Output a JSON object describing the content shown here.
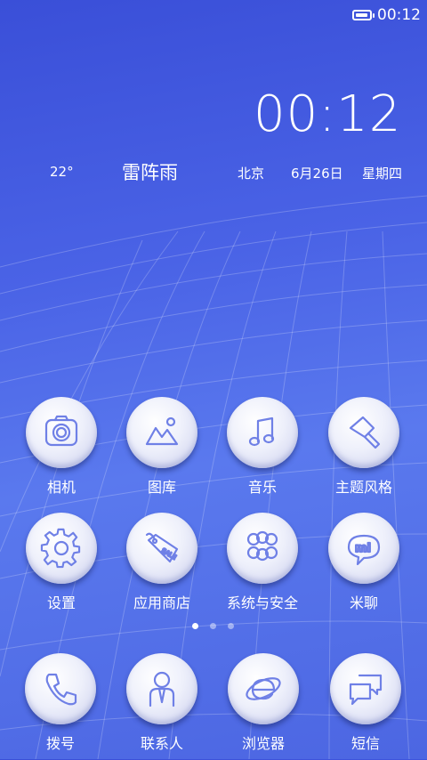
{
  "status_bar": {
    "time": "00:12",
    "battery_level": 0.95,
    "icons": [
      "battery-icon"
    ]
  },
  "lock_widget": {
    "clock": "00:12",
    "temperature": "22°",
    "condition": "雷阵雨",
    "city": "北京",
    "date": "6月26日",
    "weekday": "星期四"
  },
  "apps": [
    {
      "label": "相机",
      "icon": "camera-icon"
    },
    {
      "label": "图库",
      "icon": "gallery-icon"
    },
    {
      "label": "音乐",
      "icon": "music-icon"
    },
    {
      "label": "主题风格",
      "icon": "theme-brush-icon"
    },
    {
      "label": "设置",
      "icon": "settings-gear-icon"
    },
    {
      "label": "应用商店",
      "icon": "app-store-tag-icon"
    },
    {
      "label": "系统与安全",
      "icon": "system-security-folder-icon"
    },
    {
      "label": "米聊",
      "icon": "miliao-chat-icon"
    }
  ],
  "page_indicator": {
    "count": 3,
    "active": 1
  },
  "dock": [
    {
      "label": "拨号",
      "icon": "phone-icon"
    },
    {
      "label": "联系人",
      "icon": "contacts-icon"
    },
    {
      "label": "浏览器",
      "icon": "browser-icon"
    },
    {
      "label": "短信",
      "icon": "messages-icon"
    }
  ],
  "colors": {
    "background_top": "#3a4fd8",
    "background_bottom": "#4c66e2",
    "icon_stroke": "#6f80e6",
    "bubble": "#eef0fb"
  }
}
